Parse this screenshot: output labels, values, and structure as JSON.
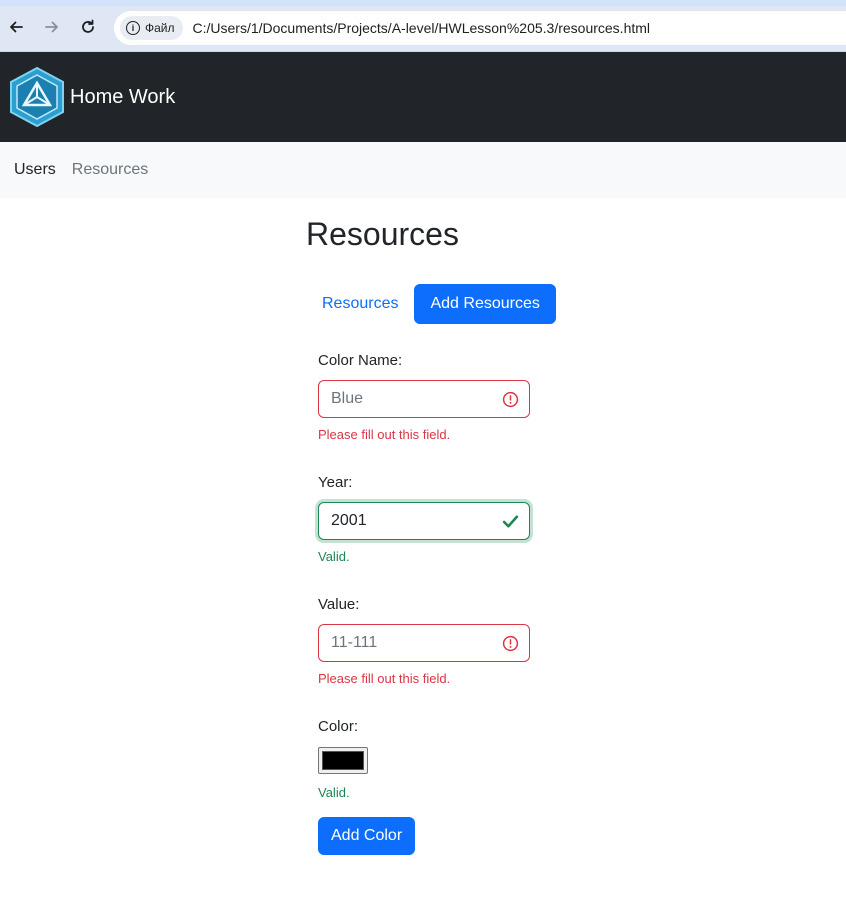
{
  "browser": {
    "chip_label": "Файл",
    "url": "C:/Users/1/Documents/Projects/A-level/HWLesson%205.3/resources.html"
  },
  "navbar": {
    "brand": "Home Work",
    "logo_icon": "ingress-hexagon-logo"
  },
  "subnav": {
    "items": [
      {
        "label": "Users",
        "active": true
      },
      {
        "label": "Resources",
        "active": false
      }
    ]
  },
  "page": {
    "title": "Resources",
    "tabs": [
      {
        "label": "Resources",
        "active": false
      },
      {
        "label": "Add Resources",
        "active": true
      }
    ]
  },
  "form": {
    "color_name": {
      "label": "Color Name:",
      "value": "Blue",
      "state": "invalid",
      "feedback": "Please fill out this field."
    },
    "year": {
      "label": "Year:",
      "value": "2001",
      "state": "valid",
      "feedback": "Valid."
    },
    "value": {
      "label": "Value:",
      "value": "11-111",
      "state": "invalid",
      "feedback": "Please fill out this field."
    },
    "color": {
      "label": "Color:",
      "value": "#000000",
      "state": "valid",
      "feedback": "Valid."
    },
    "submit_label": "Add Color"
  },
  "colors": {
    "primary": "#0d6efd",
    "danger": "#dc3545",
    "success": "#198754",
    "navbar_bg": "#212529",
    "subnav_bg": "#f8f9fa"
  }
}
